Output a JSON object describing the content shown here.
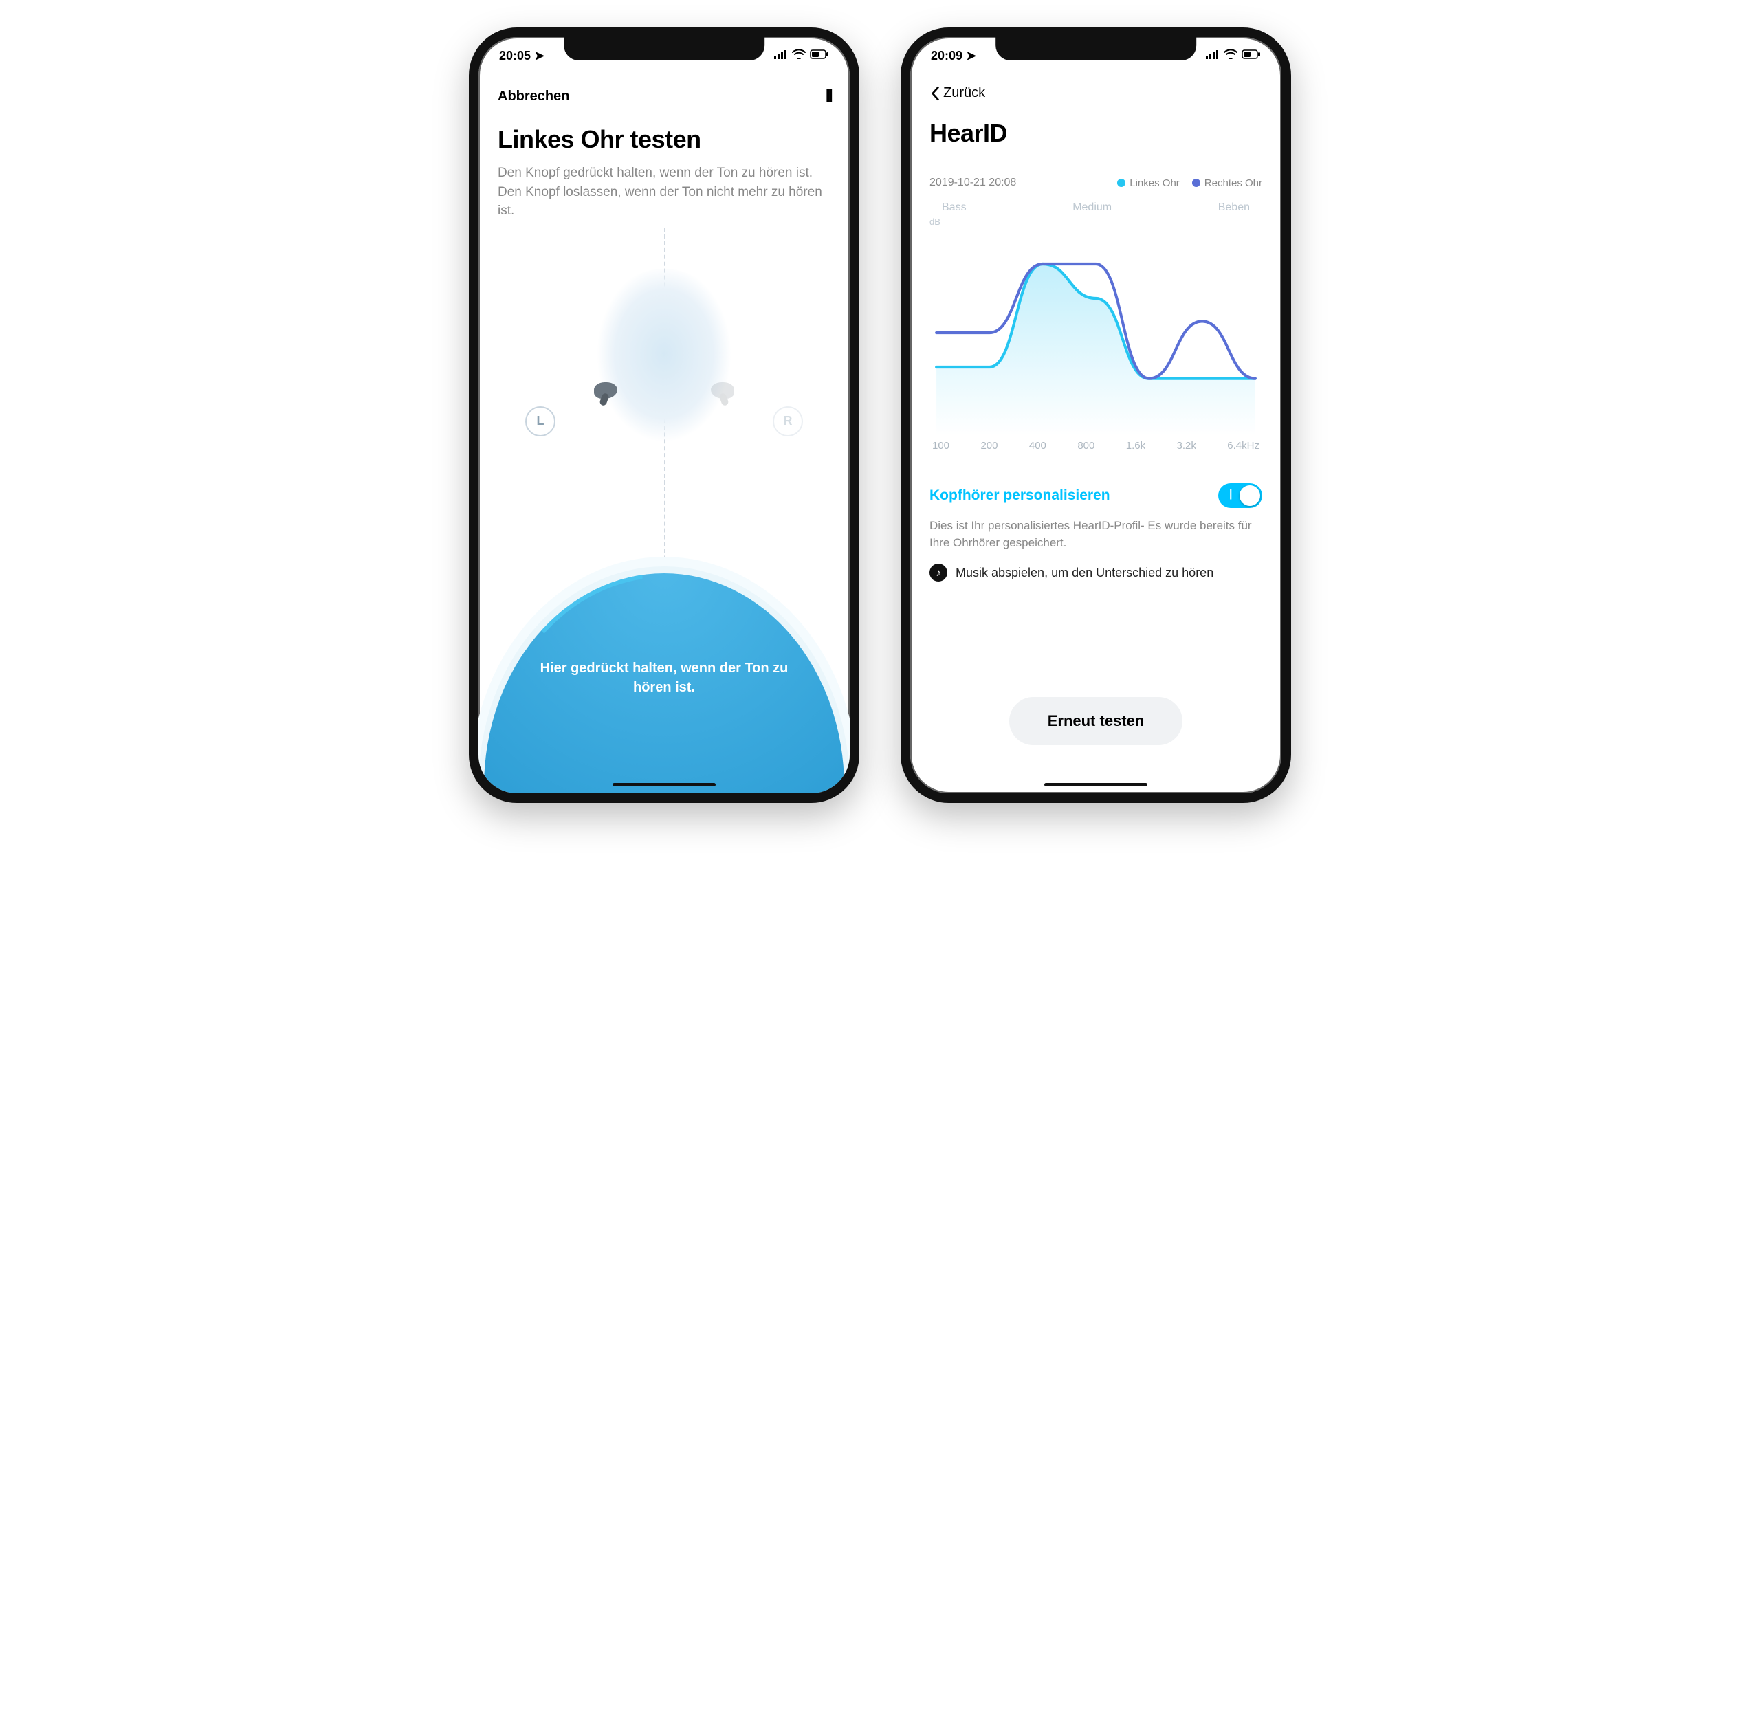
{
  "left": {
    "status": {
      "time": "20:05",
      "locIcon": "➤",
      "signal": "•ıl",
      "wifi": "wifi",
      "battery": "batt"
    },
    "nav": {
      "cancel": "Abbrechen",
      "pause": "II"
    },
    "title": "Linkes Ohr testen",
    "instr1": "Den Knopf gedrückt halten, wenn der Ton zu hören ist.",
    "instr2": "Den Knopf loslassen, wenn der Ton nicht mehr zu hören ist.",
    "earL": "L",
    "earR": "R",
    "hold": "Hier gedrückt halten, wenn der Ton zu hören ist."
  },
  "right": {
    "status": {
      "time": "20:09",
      "locIcon": "➤"
    },
    "nav": {
      "back": "Zurück"
    },
    "title": "HearID",
    "timestamp": "2019-10-21 20:08",
    "legend": {
      "left": "Linkes Ohr",
      "right": "Rechtes Ohr"
    },
    "colors": {
      "left": "#25c6f2",
      "right": "#5a6fd6"
    },
    "bands": {
      "low": "Bass",
      "mid": "Medium",
      "high": "Beben"
    },
    "dbLabel": "dB",
    "xticks": [
      "100",
      "200",
      "400",
      "800",
      "1.6k",
      "3.2k",
      "6.4kHz"
    ],
    "toggleLabel": "Kopfhörer personalisieren",
    "toggleOn": true,
    "desc": "Dies ist Ihr personalisiertes HearID-Profil- Es wurde bereits für Ihre Ohrhörer gespeichert.",
    "music": "Musik abspielen, um den Unterschied zu hören",
    "retest": "Erneut testen"
  },
  "chart_data": {
    "type": "line",
    "title": "HearID",
    "xlabel": "Hz",
    "ylabel": "dB",
    "x": [
      100,
      200,
      400,
      800,
      1600,
      3200,
      6400
    ],
    "ylim": [
      -6,
      12
    ],
    "series": [
      {
        "name": "Linkes Ohr",
        "color": "#25c6f2",
        "values": [
          0,
          0,
          9,
          6,
          -1,
          -1,
          -1
        ]
      },
      {
        "name": "Rechtes Ohr",
        "color": "#5a6fd6",
        "values": [
          3,
          3,
          9,
          9,
          -1,
          4,
          -1
        ]
      }
    ]
  }
}
